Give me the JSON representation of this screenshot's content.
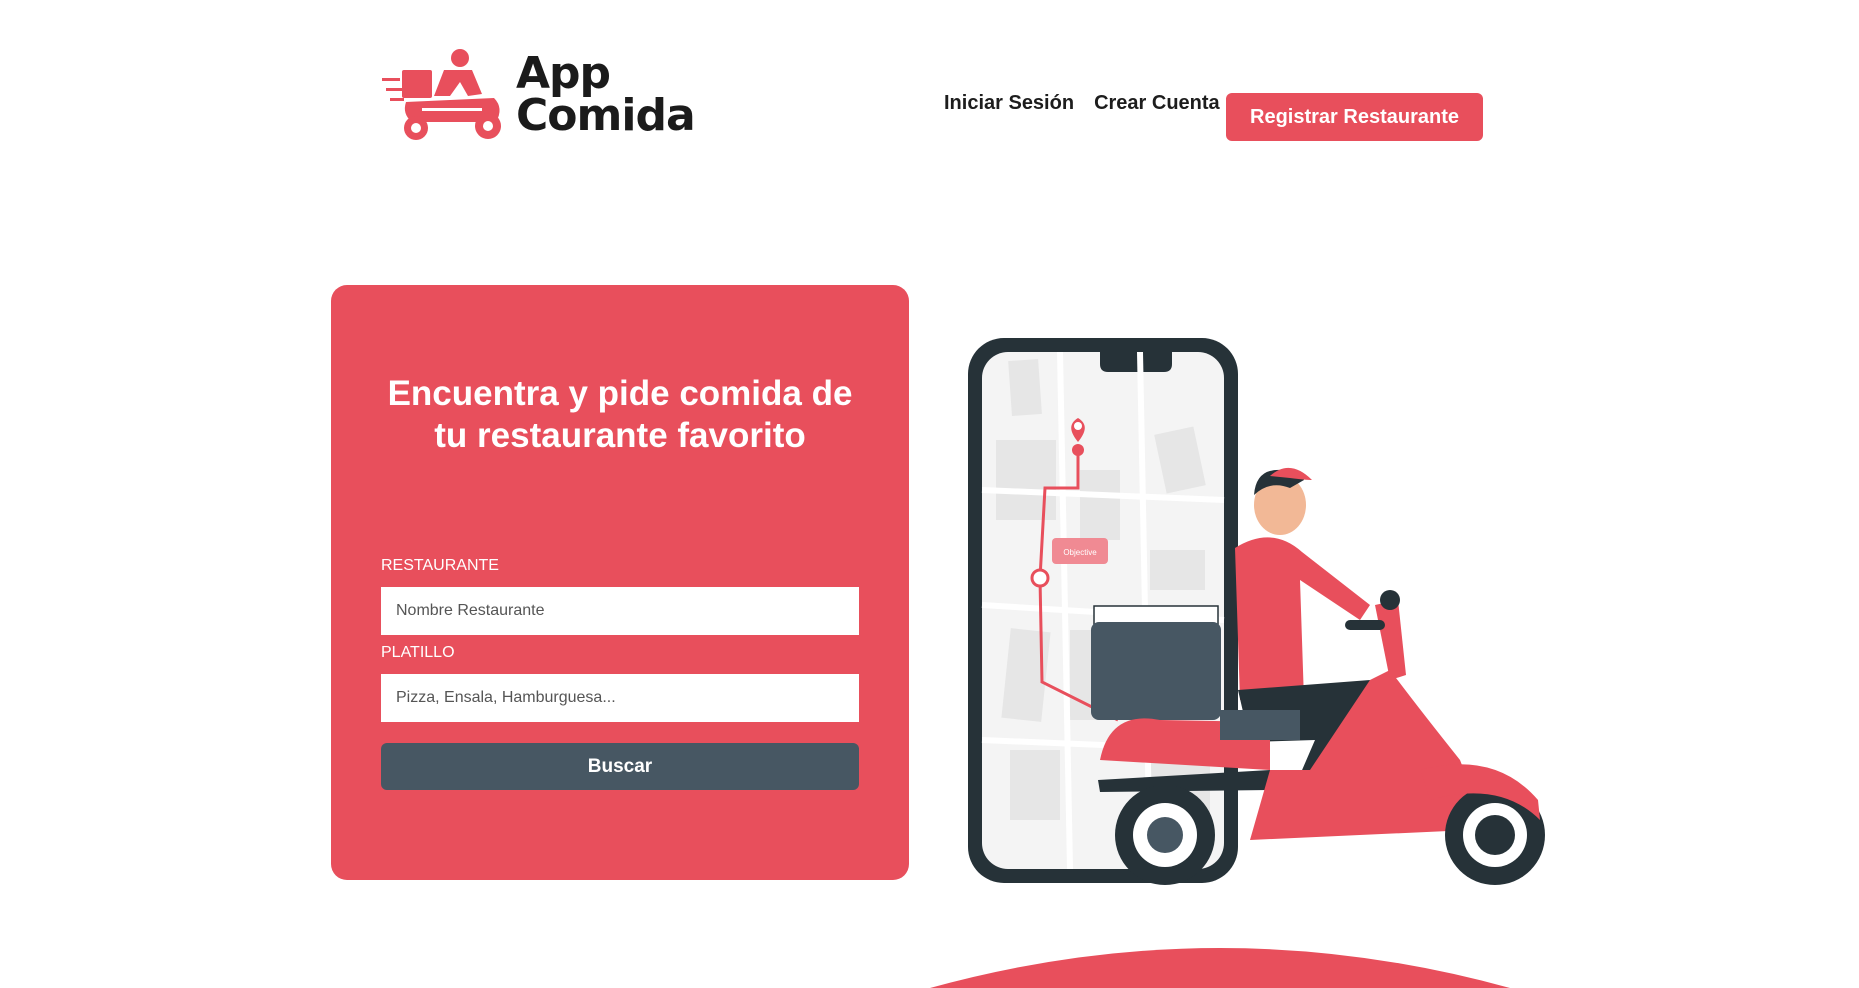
{
  "header": {
    "logo_line1": "App",
    "logo_line2": "Comida",
    "nav": {
      "login_label": "Iniciar Sesión",
      "signup_label": "Crear Cuenta",
      "register_restaurant_label": "Registrar Restaurante"
    }
  },
  "search_card": {
    "title": "Encuentra y pide comida de tu restaurante favorito",
    "restaurant_label": "RESTAURANTE",
    "restaurant_placeholder": "Nombre Restaurante",
    "dish_label": "PLATILLO",
    "dish_placeholder": "Pizza, Ensala, Hamburguesa...",
    "search_button_label": "Buscar"
  },
  "illustration": {
    "map_tag": "Objective",
    "icons": [
      "delivery-scooter-logo-icon",
      "map-pin-icon"
    ]
  },
  "colors": {
    "brand_red": "#e84f5c",
    "dark_slate": "#475763",
    "text_dark": "#1d1d1d"
  }
}
